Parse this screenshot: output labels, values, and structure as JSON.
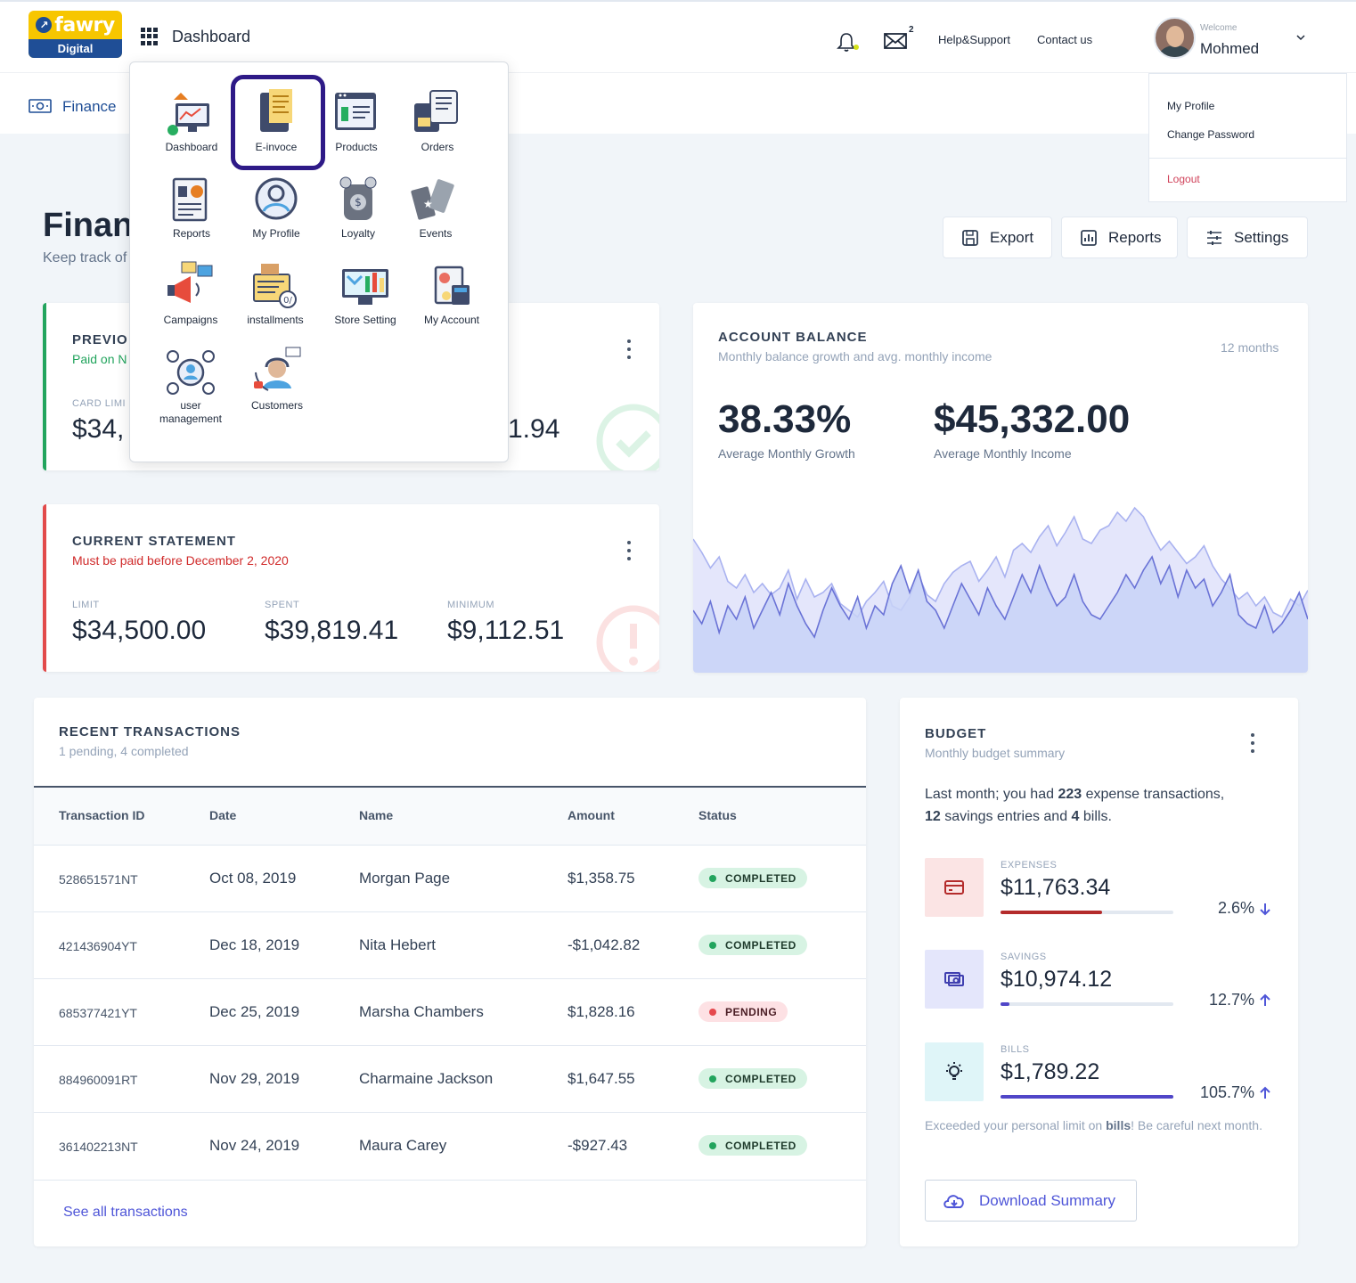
{
  "topbar": {
    "logo_top": "fawry",
    "logo_bottom": "Digital",
    "nav_title": "Dashboard",
    "mail_count": "2",
    "help_link": "Help&Support",
    "contact_link": "Contact us",
    "welcome": "Welcome",
    "user_name": "Mohmed"
  },
  "breadcrumb": {
    "label": "Finance"
  },
  "user_menu": {
    "my_profile": "My Profile",
    "change_password": "Change Password",
    "logout": "Logout"
  },
  "header": {
    "title": "Finan",
    "subtitle": "Keep track of",
    "export": "Export",
    "reports": "Reports",
    "settings": "Settings"
  },
  "launcher": {
    "apps": [
      {
        "label": "Dashboard",
        "icon": "dashboard-icon"
      },
      {
        "label": "E-invoce",
        "icon": "e-invoice-icon"
      },
      {
        "label": "Products",
        "icon": "products-icon"
      },
      {
        "label": "Orders",
        "icon": "orders-icon"
      },
      {
        "label": "Reports",
        "icon": "reports-icon"
      },
      {
        "label": "My Profile",
        "icon": "profile-icon"
      },
      {
        "label": "Loyalty",
        "icon": "loyalty-icon"
      },
      {
        "label": "Events",
        "icon": "events-icon"
      },
      {
        "label": "Campaigns",
        "icon": "campaigns-icon"
      },
      {
        "label": "installments",
        "icon": "installments-icon"
      },
      {
        "label": "Store Setting",
        "icon": "store-setting-icon"
      },
      {
        "label": "My Account",
        "icon": "account-icon"
      },
      {
        "label": "user management",
        "icon": "user-management-icon"
      },
      {
        "label": "Customers",
        "icon": "customers-icon"
      }
    ]
  },
  "previous_statement": {
    "title": "PREVIO",
    "subtitle": "Paid on N",
    "card_limit_label": "CARD LIMI",
    "card_limit_value": "$34,",
    "partial_value": "1.94"
  },
  "current_statement": {
    "title": "CURRENT STATEMENT",
    "subtitle": "Must be paid before December 2, 2020",
    "limit_label": "LIMIT",
    "limit_value": "$34,500.00",
    "spent_label": "SPENT",
    "spent_value": "$39,819.41",
    "minimum_label": "MINIMUM",
    "minimum_value": "$9,112.51"
  },
  "account_balance": {
    "title": "ACCOUNT BALANCE",
    "subtitle": "Monthly balance growth and avg. monthly income",
    "range": "12 months",
    "growth_value": "38.33%",
    "growth_label": "Average Monthly Growth",
    "income_value": "$45,332.00",
    "income_label": "Average Monthly Income"
  },
  "chart_data": {
    "type": "area",
    "series": [
      {
        "values": [
          60,
          54,
          47,
          52,
          41,
          38,
          44,
          36,
          40,
          35,
          38,
          46,
          33,
          42,
          34,
          36,
          40,
          31,
          28,
          25,
          32,
          36,
          41,
          30,
          28,
          34,
          44,
          35,
          32,
          40,
          45,
          48,
          50,
          41,
          46,
          52,
          43,
          55,
          58,
          54,
          61,
          66,
          57,
          63,
          70,
          60,
          58,
          64,
          66,
          72,
          68,
          74,
          70,
          62,
          55,
          59,
          54,
          49,
          52,
          57,
          48,
          42,
          38,
          33,
          36,
          30,
          34,
          27,
          25,
          33,
          30,
          37
        ]
      },
      {
        "values": [
          28,
          22,
          32,
          18,
          30,
          24,
          34,
          20,
          28,
          36,
          26,
          40,
          30,
          22,
          16,
          28,
          38,
          30,
          24,
          34,
          20,
          30,
          26,
          40,
          48,
          36,
          46,
          32,
          28,
          20,
          30,
          40,
          33,
          26,
          38,
          30,
          24,
          34,
          44,
          36,
          48,
          38,
          30,
          34,
          44,
          32,
          26,
          24,
          30,
          36,
          44,
          38,
          46,
          52,
          40,
          48,
          34,
          46,
          38,
          42,
          30,
          36,
          44,
          26,
          22,
          20,
          30,
          18,
          22,
          28,
          36,
          24
        ]
      }
    ]
  },
  "transactions": {
    "title": "RECENT TRANSACTIONS",
    "subtitle": "1 pending, 4 completed",
    "columns": [
      "Transaction ID",
      "Date",
      "Name",
      "Amount",
      "Status"
    ],
    "rows": [
      {
        "id": "528651571NT",
        "date": "Oct 08, 2019",
        "name": "Morgan Page",
        "amount": "$1,358.75",
        "status": "COMPLETED"
      },
      {
        "id": "421436904YT",
        "date": "Dec 18, 2019",
        "name": "Nita Hebert",
        "amount": "-$1,042.82",
        "status": "COMPLETED"
      },
      {
        "id": "685377421YT",
        "date": "Dec 25, 2019",
        "name": "Marsha Chambers",
        "amount": "$1,828.16",
        "status": "PENDING"
      },
      {
        "id": "884960091RT",
        "date": "Nov 29, 2019",
        "name": "Charmaine Jackson",
        "amount": "$1,647.55",
        "status": "COMPLETED"
      },
      {
        "id": "361402213NT",
        "date": "Nov 24, 2019",
        "name": "Maura Carey",
        "amount": "-$927.43",
        "status": "COMPLETED"
      }
    ],
    "see_all": "See all transactions"
  },
  "budget": {
    "title": "BUDGET",
    "subtitle": "Monthly budget summary",
    "summary_1": "Last month; you had ",
    "expense_count": "223",
    "summary_2": " expense transactions,",
    "savings_count": "12",
    "summary_3": " savings entries and ",
    "bills_count": "4",
    "summary_4": " bills.",
    "items": [
      {
        "label": "EXPENSES",
        "value": "$11,763.34",
        "change": "2.6%",
        "direction": "down",
        "fill": 0.59,
        "color": "#b42b2b",
        "icon": "credit-card-icon"
      },
      {
        "label": "SAVINGS",
        "value": "$10,974.12",
        "change": "12.7%",
        "direction": "up",
        "fill": 0.05,
        "color": "#5046c8",
        "icon": "cash-icon"
      },
      {
        "label": "BILLS",
        "value": "$1,789.22",
        "change": "105.7%",
        "direction": "up",
        "fill": 1.0,
        "color": "#5046c8",
        "icon": "lightbulb-icon"
      }
    ],
    "warning_1": "Exceeded your personal limit on ",
    "warning_bold": "bills",
    "warning_2": "! Be careful next month.",
    "download": "Download Summary"
  }
}
